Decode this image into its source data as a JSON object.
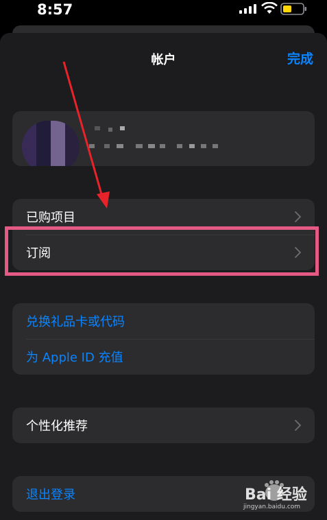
{
  "status_bar": {
    "time": "8:57"
  },
  "nav": {
    "title": "帐户",
    "done_label": "完成"
  },
  "account": {},
  "menu_group_1": {
    "purchased": "已购项目",
    "subscriptions": "订阅"
  },
  "menu_group_2": {
    "redeem": "兑换礼品卡或代码",
    "add_funds": "为 Apple ID 充值"
  },
  "menu_group_3": {
    "personalized": "个性化推荐"
  },
  "menu_group_4": {
    "sign_out": "退出登录"
  },
  "watermark": {
    "text": "Bai 经验",
    "url": "jingyan.baidu.com"
  },
  "colors": {
    "accent": "#0a84ff",
    "highlight": "#e55a84",
    "arrow": "#e8232a"
  }
}
